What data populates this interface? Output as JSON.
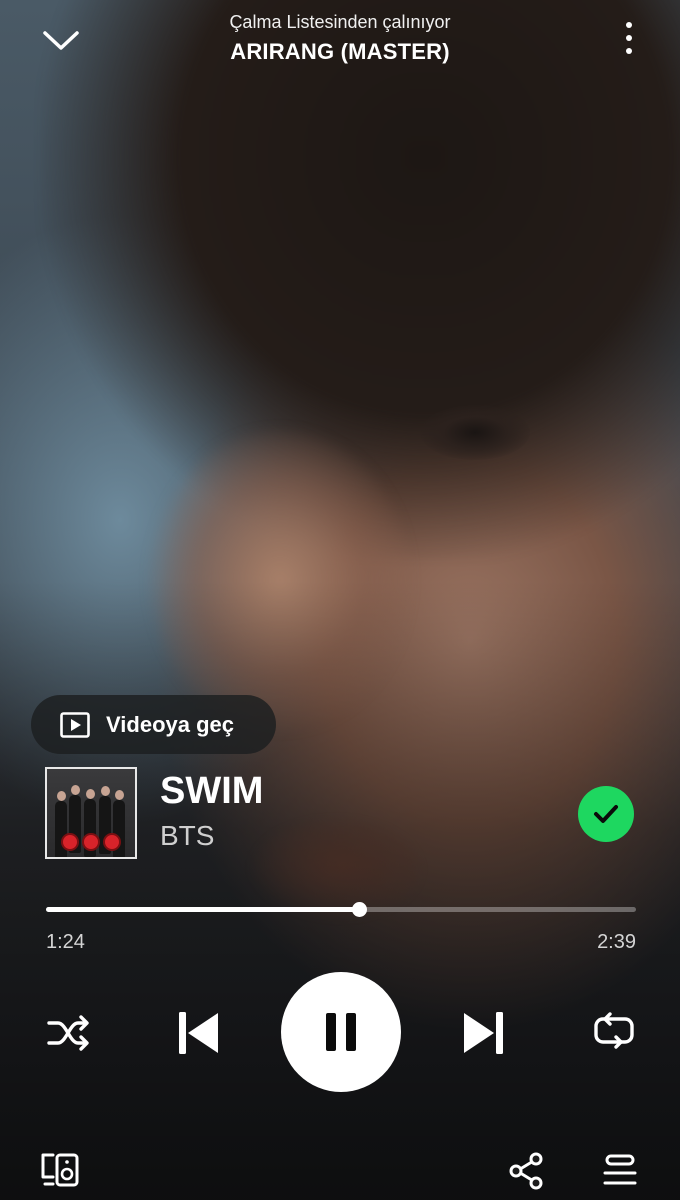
{
  "header": {
    "context_subtitle": "Çalma Listesinden çalınıyor",
    "context_title": "ARIRANG (MASTER)",
    "collapse_icon": "chevron-down-icon",
    "more_icon": "more-vertical-icon"
  },
  "canvas": {
    "switch_to_video_label": "Videoya geç",
    "switch_to_video_icon": "play-square-icon"
  },
  "track": {
    "title": "SWIM",
    "artist": "BTS",
    "saved": true,
    "saved_icon": "check-icon",
    "saved_color": "#1ed760"
  },
  "playback": {
    "elapsed": "1:24",
    "duration": "2:39",
    "progress_fraction": 0.53,
    "is_playing": true
  },
  "controls": {
    "shuffle_icon": "shuffle-icon",
    "previous_icon": "skip-previous-icon",
    "pause_icon": "pause-icon",
    "next_icon": "skip-next-icon",
    "repeat_icon": "repeat-icon"
  },
  "footer": {
    "devices_icon": "connect-devices-icon",
    "share_icon": "share-icon",
    "queue_icon": "queue-icon"
  }
}
